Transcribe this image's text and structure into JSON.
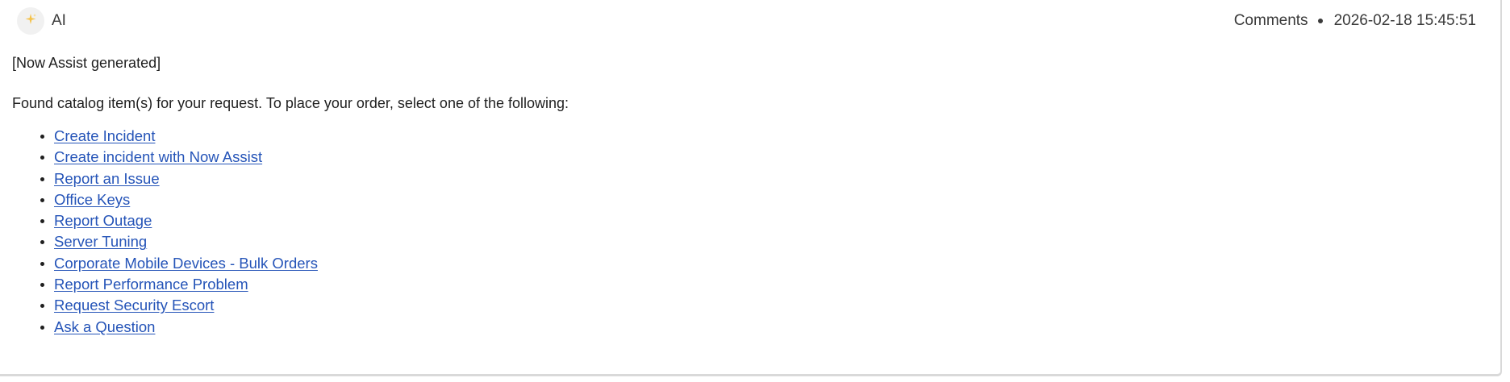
{
  "entry": {
    "author": "AI",
    "type": "Comments",
    "timestamp": "2026-02-18 15:45:51",
    "avatar_icon": "sparkle-icon",
    "avatar_icon_color": "#f5c24a"
  },
  "message": {
    "generated_tag": "[Now Assist generated]",
    "intro": "Found catalog item(s) for your request. To place your order, select one of the following:",
    "items": [
      {
        "label": "Create Incident"
      },
      {
        "label": "Create incident with Now Assist"
      },
      {
        "label": "Report an Issue"
      },
      {
        "label": "Office Keys"
      },
      {
        "label": "Report Outage"
      },
      {
        "label": "Server Tuning"
      },
      {
        "label": "Corporate Mobile Devices - Bulk Orders"
      },
      {
        "label": "Report Performance Problem"
      },
      {
        "label": "Request Security Escort"
      },
      {
        "label": "Ask a Question"
      }
    ]
  },
  "colors": {
    "link": "#2554b8",
    "text": "#1f1f1f",
    "meta_text": "#3a3a3a"
  }
}
